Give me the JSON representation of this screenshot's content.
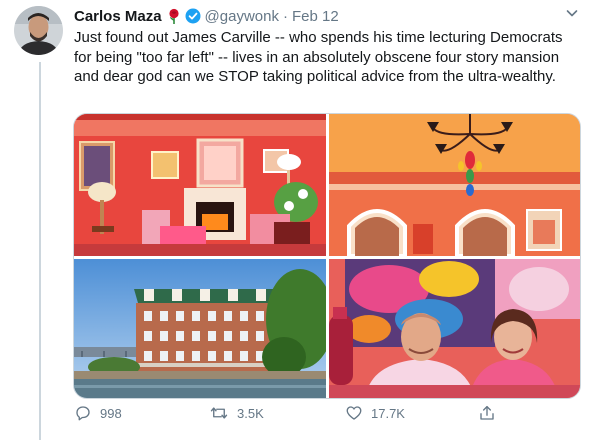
{
  "tweet": {
    "author_name": "Carlos Maza",
    "handle": "@gaywonk",
    "separator": "·",
    "date": "Feb 12",
    "text": "Just found out James Carville -- who spends his time lecturing Democrats for being \"too far left\" -- lives in an absolutely obscene four story mansion and dear god can we STOP taking political advice from the ultra-wealthy."
  },
  "actions": {
    "replies": "998",
    "retweets": "3.5K",
    "likes": "17.7K"
  },
  "colors": {
    "text": "#14171a",
    "secondary": "#657786",
    "verified": "#1da1f2",
    "border": "#ccd6dd"
  },
  "icons": [
    "avatar",
    "rose-icon",
    "verified-badge-icon",
    "chevron-down-icon",
    "reply-icon",
    "retweet-icon",
    "like-icon",
    "share-icon"
  ]
}
